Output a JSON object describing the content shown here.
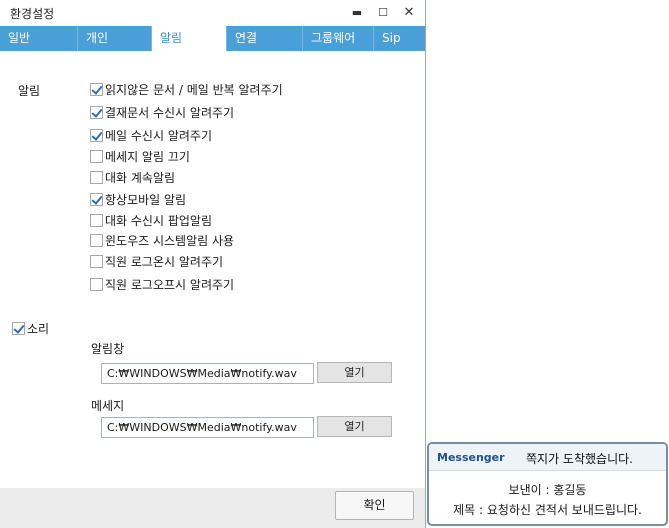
{
  "window": {
    "title": "환경설정",
    "minimize": "▬",
    "maximize": "☐",
    "close": "✕"
  },
  "tabs": [
    {
      "label": "일반"
    },
    {
      "label": "개인"
    },
    {
      "label": "알림",
      "active": true
    },
    {
      "label": "연결"
    },
    {
      "label": "그룹웨어"
    },
    {
      "label": "Sip"
    }
  ],
  "alerts": {
    "section_label": "알림",
    "options": [
      {
        "label": "읽지않은 문서 / 메일 반복 알려주기",
        "checked": true
      },
      {
        "label": "결재문서 수신시 알려주기",
        "checked": true
      },
      {
        "label": "메일 수신시 알려주기",
        "checked": true
      },
      {
        "label": "메세지 알림 끄기",
        "checked": false
      },
      {
        "label": "대화 계속알림",
        "checked": false
      },
      {
        "label": "항상모바일 알림",
        "checked": true
      },
      {
        "label": "대화 수신시 팝업알림",
        "checked": false
      },
      {
        "label": "윈도우즈 시스템알림 사용",
        "checked": false
      },
      {
        "label": "직원 로그온시 알려주기",
        "checked": false
      },
      {
        "label": "직원 로그오프시 알려주기",
        "checked": false
      }
    ]
  },
  "sound": {
    "label": "소리",
    "checked": true,
    "alert_window": {
      "label": "알림창",
      "path": "C:₩WINDOWS₩Media₩notify.wav",
      "open_label": "열기"
    },
    "message": {
      "label": "메세지",
      "path": "C:₩WINDOWS₩Media₩notify.wav",
      "open_label": "열기"
    }
  },
  "footer": {
    "ok_label": "확인"
  },
  "popup": {
    "brand": "Messenger",
    "title": "쪽지가 도착했습니다.",
    "sender": "보낸이 : 홍길동",
    "subject": "제목 : 요청하신 견적서 보내드립니다."
  }
}
